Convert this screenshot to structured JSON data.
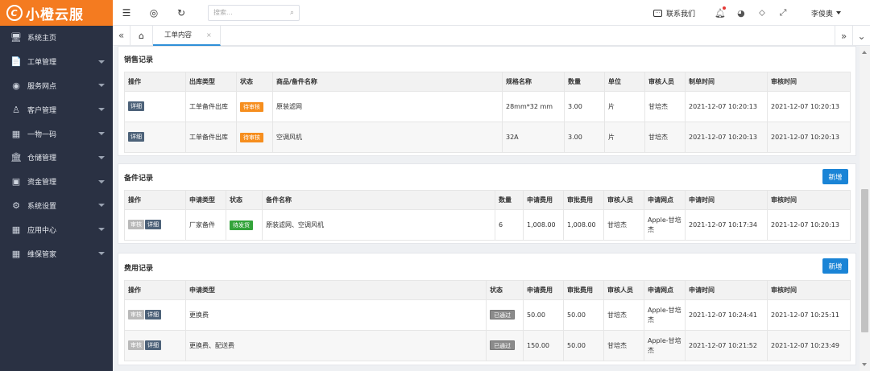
{
  "app": {
    "logo_text": "小橙云服",
    "logo_mark": "C"
  },
  "sidebar": {
    "items": [
      {
        "label": "系统主页",
        "icon": "monitor-icon",
        "glyph": "🖥",
        "arrow": false
      },
      {
        "label": "工单管理",
        "icon": "document-icon",
        "glyph": "📄",
        "arrow": true
      },
      {
        "label": "服务网点",
        "icon": "globe-icon",
        "glyph": "◉",
        "arrow": true
      },
      {
        "label": "客户管理",
        "icon": "user-icon",
        "glyph": "♙",
        "arrow": true
      },
      {
        "label": "一物一码",
        "icon": "grid-icon",
        "glyph": "▦",
        "arrow": true
      },
      {
        "label": "仓储管理",
        "icon": "bank-icon",
        "glyph": "🏛",
        "arrow": true
      },
      {
        "label": "资金管理",
        "icon": "money-icon",
        "glyph": "▣",
        "arrow": true
      },
      {
        "label": "系统设置",
        "icon": "gear-icon",
        "glyph": "⚙",
        "arrow": true
      },
      {
        "label": "应用中心",
        "icon": "grid-icon",
        "glyph": "▦",
        "arrow": true
      },
      {
        "label": "维保管家",
        "icon": "grid-icon",
        "glyph": "▦",
        "arrow": true
      }
    ]
  },
  "topbar": {
    "search_placeholder": "搜索...",
    "contact_label": "联系我们",
    "user_name": "李俊奥"
  },
  "tabs": {
    "items": [
      {
        "label": "工单内容",
        "close": "×"
      }
    ]
  },
  "sales": {
    "title": "销售记录",
    "headers": [
      "操作",
      "出库类型",
      "状态",
      "商品/备件名称",
      "规格名称",
      "数量",
      "单位",
      "审核人员",
      "制单时间",
      "审核时间"
    ],
    "rows": [
      {
        "actions": [
          "详细"
        ],
        "type": "工单备件出库",
        "status": "待审核",
        "name": "原装滤网",
        "spec": "28mm*32 mm",
        "qty": "3.00",
        "unit": "片",
        "reviewer": "甘培杰",
        "created": "2021-12-07 10:20:13",
        "reviewed": "2021-12-07 10:20:13"
      },
      {
        "actions": [
          "详细"
        ],
        "type": "工单备件出库",
        "status": "待审核",
        "name": "空调风机",
        "spec": "32A",
        "qty": "3.00",
        "unit": "片",
        "reviewer": "甘培杰",
        "created": "2021-12-07 10:20:13",
        "reviewed": "2021-12-07 10:20:13"
      }
    ]
  },
  "spares": {
    "title": "备件记录",
    "add_label": "新增",
    "headers": [
      "操作",
      "申请类型",
      "状态",
      "备件名称",
      "数量",
      "申请费用",
      "审批费用",
      "审核人员",
      "申请网点",
      "申请时间",
      "审核时间"
    ],
    "rows": [
      {
        "actions": [
          "审核",
          "详细"
        ],
        "type": "厂家备件",
        "status": "待发货",
        "name": "原装滤网、空调风机",
        "qty": "6",
        "apply_fee": "1,008.00",
        "approve_fee": "1,008.00",
        "reviewer": "甘培杰",
        "outlet": "Apple-甘培杰",
        "applied": "2021-12-07 10:17:34",
        "reviewed": "2021-12-07 10:20:13"
      }
    ]
  },
  "fees": {
    "title": "费用记录",
    "add_label": "新增",
    "headers": [
      "操作",
      "申请类型",
      "状态",
      "申请费用",
      "审批费用",
      "审核人员",
      "申请网点",
      "申请时间",
      "审核时间"
    ],
    "rows": [
      {
        "actions": [
          "审核",
          "详细"
        ],
        "type": "更换费",
        "status": "已通过",
        "apply_fee": "50.00",
        "approve_fee": "50.00",
        "reviewer": "甘培杰",
        "outlet": "Apple-甘培杰",
        "applied": "2021-12-07 10:24:41",
        "reviewed": "2021-12-07 10:25:11"
      },
      {
        "actions": [
          "审核",
          "详细"
        ],
        "type": "更换费、配送费",
        "status": "已通过",
        "apply_fee": "150.00",
        "approve_fee": "50.00",
        "reviewer": "甘培杰",
        "outlet": "Apple-甘培杰",
        "applied": "2021-12-07 10:21:52",
        "reviewed": "2021-12-07 10:23:49"
      }
    ]
  },
  "colors": {
    "brand": "#f47b20",
    "sidebar_bg": "#2a3143",
    "primary_button": "#1a84d6",
    "status_pending": "#f68e1e",
    "status_shipping": "#33a33a",
    "status_passed": "#8b8b8b"
  }
}
